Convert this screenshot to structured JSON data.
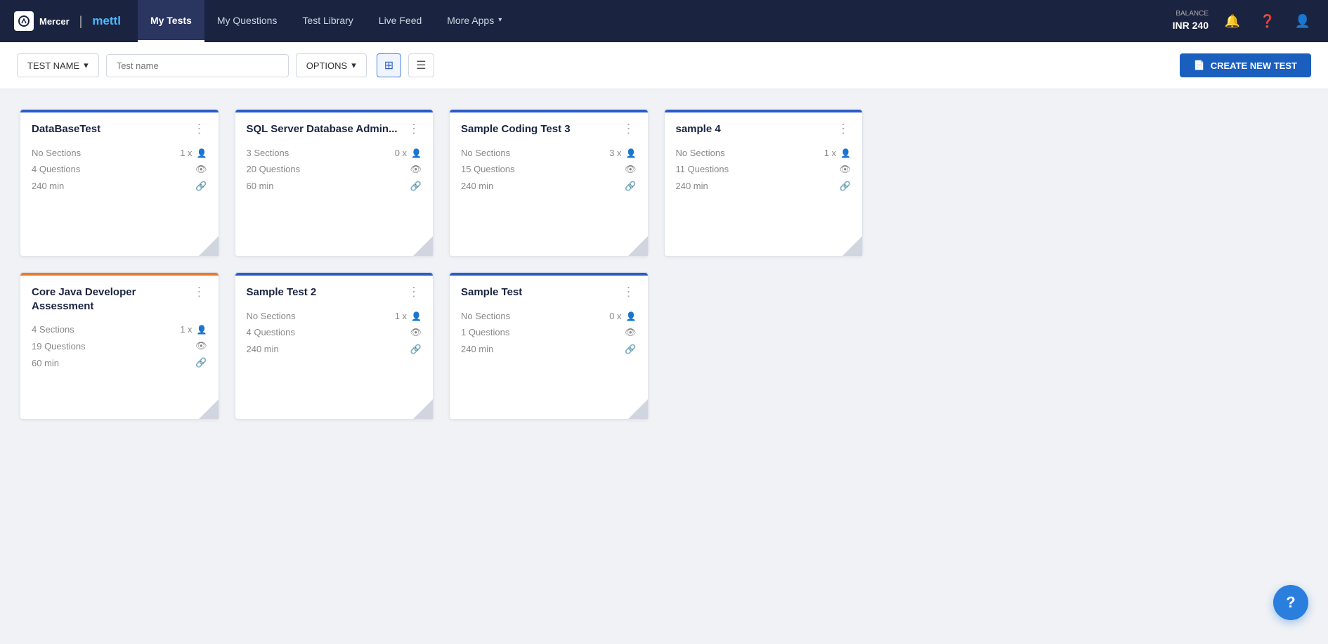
{
  "navbar": {
    "logo_mercer": "Mercer",
    "logo_sep": "|",
    "logo_mettl": "mettl",
    "nav_items": [
      {
        "id": "my-tests",
        "label": "My Tests",
        "active": true
      },
      {
        "id": "my-questions",
        "label": "My Questions",
        "active": false
      },
      {
        "id": "test-library",
        "label": "Test Library",
        "active": false
      },
      {
        "id": "live-feed",
        "label": "Live Feed",
        "active": false
      },
      {
        "id": "more-apps",
        "label": "More Apps",
        "active": false,
        "dropdown": true
      }
    ],
    "balance_label": "BALANCE",
    "balance_value": "INR 240"
  },
  "toolbar": {
    "filter_label": "TEST NAME",
    "search_placeholder": "Test name",
    "options_label": "OPTIONS",
    "create_label": "CREATE NEW TEST"
  },
  "tests": [
    {
      "id": "database-test",
      "title": "DataBaseTest",
      "bar_color": "blue",
      "sections": "No Sections",
      "invites": "1 x",
      "questions": "4 Questions",
      "duration": "240 min"
    },
    {
      "id": "sql-server",
      "title": "SQL Server Database Admin...",
      "bar_color": "blue",
      "sections": "3 Sections",
      "invites": "0 x",
      "questions": "20 Questions",
      "duration": "60 min"
    },
    {
      "id": "sample-coding-3",
      "title": "Sample Coding Test 3",
      "bar_color": "blue",
      "sections": "No Sections",
      "invites": "3 x",
      "questions": "15 Questions",
      "duration": "240 min"
    },
    {
      "id": "sample-4",
      "title": "sample 4",
      "bar_color": "blue",
      "sections": "No Sections",
      "invites": "1 x",
      "questions": "11 Questions",
      "duration": "240 min"
    },
    {
      "id": "core-java",
      "title": "Core Java Developer Assessment",
      "bar_color": "orange",
      "sections": "4 Sections",
      "invites": "1 x",
      "questions": "19 Questions",
      "duration": "60 min"
    },
    {
      "id": "sample-test-2",
      "title": "Sample Test 2",
      "bar_color": "blue",
      "sections": "No Sections",
      "invites": "1 x",
      "questions": "4 Questions",
      "duration": "240 min"
    },
    {
      "id": "sample-test",
      "title": "Sample Test",
      "bar_color": "blue",
      "sections": "No Sections",
      "invites": "0 x",
      "questions": "1 Questions",
      "duration": "240 min"
    }
  ],
  "help": {
    "label": "?"
  }
}
